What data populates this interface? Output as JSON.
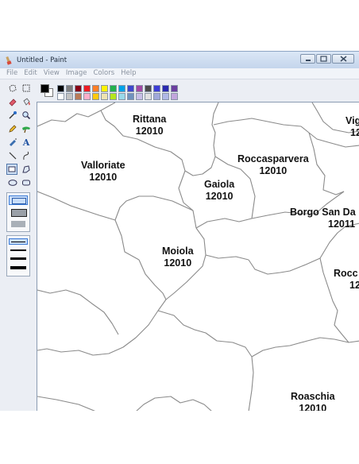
{
  "window": {
    "title": "Untitled - Paint",
    "icon": "paint-brush-icon"
  },
  "menu": [
    "File",
    "Edit",
    "View",
    "Image",
    "Colors",
    "Help"
  ],
  "tools": [
    {
      "name": "free-form-select-icon"
    },
    {
      "name": "rectangle-select-icon"
    },
    {
      "name": "eraser-icon"
    },
    {
      "name": "fill-bucket-icon"
    },
    {
      "name": "color-picker-icon"
    },
    {
      "name": "magnifier-icon"
    },
    {
      "name": "pencil-icon"
    },
    {
      "name": "brush-icon"
    },
    {
      "name": "airbrush-icon"
    },
    {
      "name": "text-icon",
      "glyph": "A"
    },
    {
      "name": "line-icon"
    },
    {
      "name": "curve-icon"
    },
    {
      "name": "rectangle-icon",
      "selected": true
    },
    {
      "name": "polygon-icon"
    },
    {
      "name": "ellipse-icon"
    },
    {
      "name": "rounded-rectangle-icon"
    }
  ],
  "palette": {
    "foreground": "#000000",
    "background": "#ffffff",
    "row1": [
      "#000000",
      "#7f7f7f",
      "#880015",
      "#ed1c24",
      "#ff7f27",
      "#fff200",
      "#22b14c",
      "#00a2e8",
      "#3f48cc",
      "#a349a4",
      "#4b4b4b",
      "#3d3dd6",
      "#2b2bb0",
      "#6b3fa0"
    ],
    "row2": [
      "#ffffff",
      "#c3c3c3",
      "#b97a57",
      "#ffaec9",
      "#ffc90e",
      "#efe4b0",
      "#b5e61d",
      "#99d9ea",
      "#7092be",
      "#c8bfe7",
      "#e0e0e0",
      "#9fa8da",
      "#b0b8e6",
      "#c2a6dc"
    ]
  },
  "map": {
    "regions": [
      {
        "name": "Rittana",
        "code": "12010"
      },
      {
        "name": "Valloriate",
        "code": "12010"
      },
      {
        "name": "Roccasparvera",
        "code": "12010"
      },
      {
        "name": "Gaiola",
        "code": "12010"
      },
      {
        "name": "Borgo San Da",
        "code": "12011"
      },
      {
        "name": "Moiola",
        "code": "12010"
      },
      {
        "name": "Vig",
        "code": "12"
      },
      {
        "name": "Rocc",
        "code": "12"
      },
      {
        "name": "Roaschia",
        "code": "12010"
      }
    ]
  }
}
